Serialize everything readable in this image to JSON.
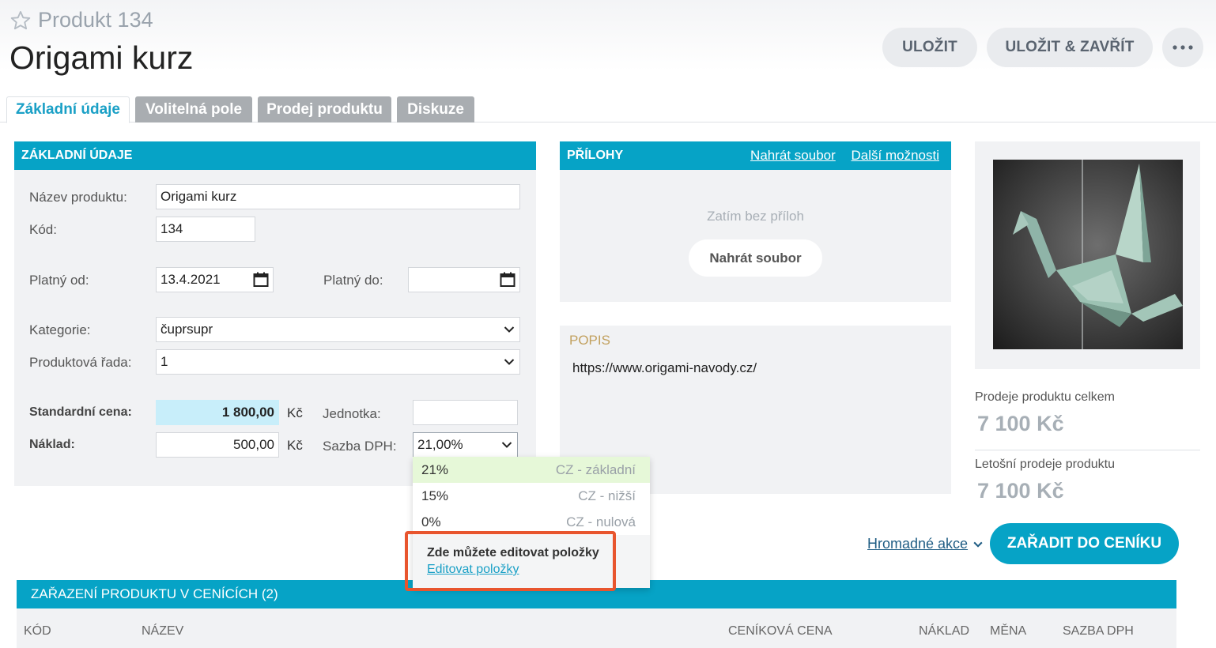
{
  "header": {
    "subtitle": "Produkt 134",
    "title": "Origami kurz",
    "save_label": "ULOŽIT",
    "save_close_label": "ULOŽIT & ZAVŘÍT",
    "more_label": "···"
  },
  "tabs": [
    {
      "label": "Základní údaje",
      "active": true
    },
    {
      "label": "Volitelná pole",
      "active": false
    },
    {
      "label": "Prodej produktu",
      "active": false
    },
    {
      "label": "Diskuze",
      "active": false
    }
  ],
  "basic": {
    "heading": "ZÁKLADNÍ ÚDAJE",
    "name_label": "Název produktu:",
    "name_value": "Origami kurz",
    "code_label": "Kód:",
    "code_value": "134",
    "valid_from_label": "Platný od:",
    "valid_from_value": "13.4.2021",
    "valid_to_label": "Platný do:",
    "valid_to_value": "",
    "category_label": "Kategorie:",
    "category_value": "čuprsupr",
    "line_label": "Produktová řada:",
    "line_value": "1",
    "price_label": "Standardní cena:",
    "price_value": "1 800,00",
    "price_currency": "Kč",
    "unit_label": "Jednotka:",
    "unit_value": "",
    "cost_label": "Náklad:",
    "cost_value": "500,00",
    "cost_currency": "Kč",
    "vat_label": "Sazba DPH:",
    "vat_value": "21,00%"
  },
  "vat_dropdown": {
    "options": [
      {
        "rate": "21%",
        "code": "CZ - základní",
        "selected": true
      },
      {
        "rate": "15%",
        "code": "CZ - nižší",
        "selected": false
      },
      {
        "rate": "0%",
        "code": "CZ - nulová",
        "selected": false
      }
    ],
    "edit_hint": "Zde můžete editovat položky",
    "edit_link": "Editovat položky"
  },
  "attachments": {
    "heading": "PŘÍLOHY",
    "upload_link": "Nahrát soubor",
    "more_link": "Další možnosti",
    "empty_text": "Zatím bez příloh",
    "upload_button": "Nahrát soubor"
  },
  "description": {
    "heading": "POPIS",
    "text": "https://www.origami-navody.cz/"
  },
  "stats": {
    "total_label": "Prodeje produktu celkem",
    "total_value": "7 100 Kč",
    "year_label": "Letošní prodeje produktu",
    "year_value": "7 100 Kč"
  },
  "actions": {
    "bulk_label": "Hromadné akce",
    "add_pricelist_label": "ZAŘADIT DO CENÍKU"
  },
  "pricelists": {
    "heading": "ZAŘAZENÍ PRODUKTU V CENÍCÍCH (2)",
    "columns": [
      "KÓD",
      "NÁZEV",
      "CENÍKOVÁ CENA",
      "NÁKLAD",
      "MĚNA",
      "SAZBA DPH"
    ]
  },
  "colors": {
    "accent": "#06a3c6",
    "link": "#1aa0c6",
    "highlight_box": "#e8552e",
    "price_bg": "#c8eefa",
    "selected_option_bg": "#e6f8d8"
  }
}
